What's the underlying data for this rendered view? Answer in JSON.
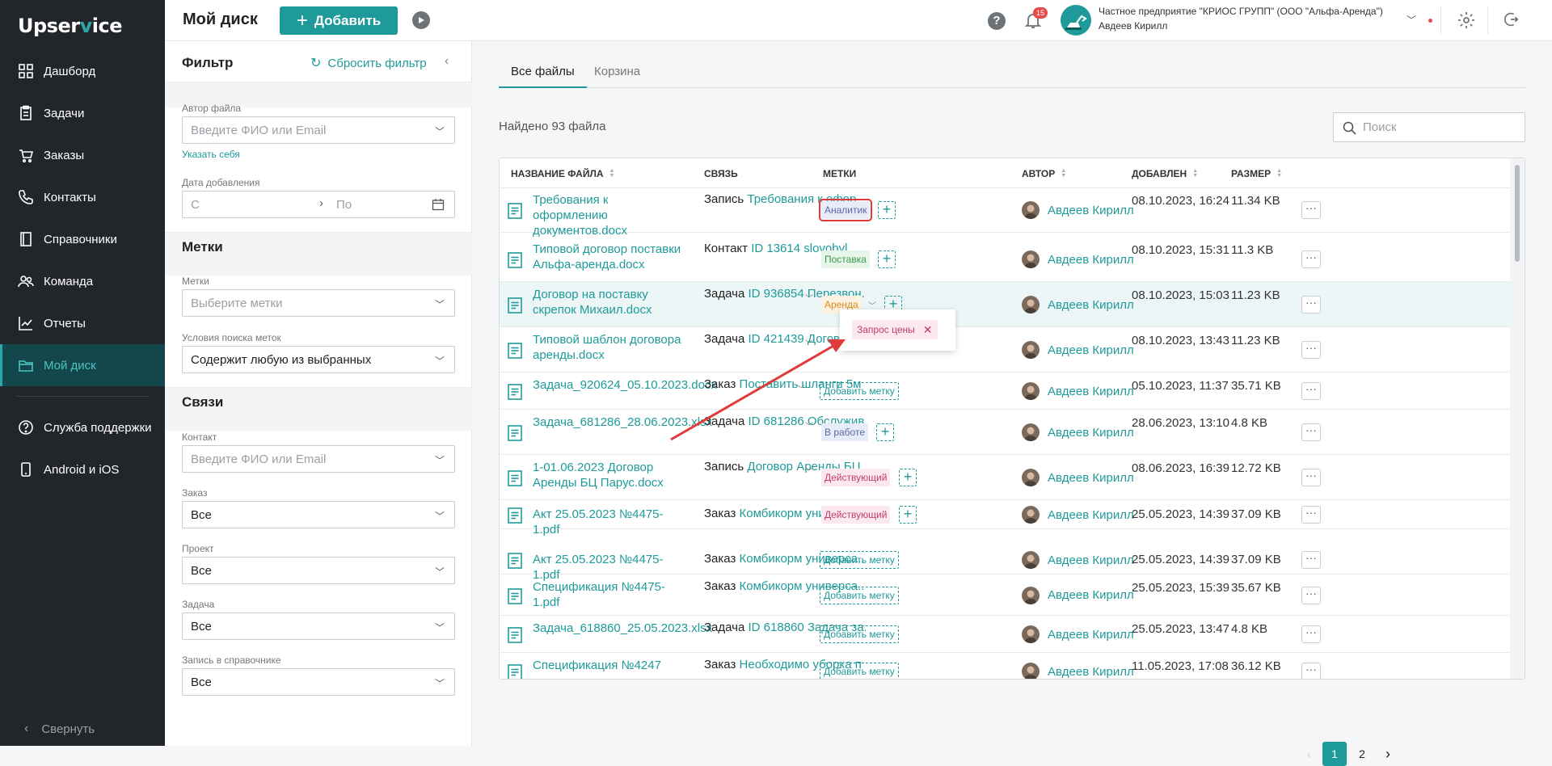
{
  "app": {
    "logo_prefix": "Upser",
    "logo_v": "v",
    "logo_suffix": "ice"
  },
  "sidebar": {
    "items": [
      {
        "label": "Дашборд",
        "icon": "grid-icon"
      },
      {
        "label": "Задачи",
        "icon": "clipboard-icon"
      },
      {
        "label": "Заказы",
        "icon": "cart-icon"
      },
      {
        "label": "Контакты",
        "icon": "phone-icon"
      },
      {
        "label": "Справочники",
        "icon": "book-icon"
      },
      {
        "label": "Команда",
        "icon": "team-icon"
      },
      {
        "label": "Отчеты",
        "icon": "chart-icon"
      },
      {
        "label": "Мой диск",
        "icon": "folder-icon"
      }
    ],
    "bottom_items": [
      {
        "label": "Служба поддержки",
        "icon": "help-icon"
      },
      {
        "label": "Android и iOS",
        "icon": "mobile-icon"
      }
    ],
    "collapse_label": "Свернуть"
  },
  "header": {
    "title": "Мой диск",
    "add_label": "Добавить",
    "notifications_count": "15",
    "company": "Частное предприятие \"КРИОС ГРУПП\" (ООО \"Альфа-Аренда\")",
    "user": "Авдеев Кирилл"
  },
  "filter": {
    "title": "Фильтр",
    "reset_label": "Сбросить фильтр",
    "author_label": "Автор файла",
    "author_placeholder": "Введите ФИО или Email",
    "self_link": "Указать себя",
    "date_label": "Дата добавления",
    "date_from": "С",
    "date_to": "По",
    "tags_section": "Метки",
    "tags_label": "Метки",
    "tags_placeholder": "Выберите метки",
    "cond_label": "Условия поиска меток",
    "cond_value": "Содержит любую из выбранных",
    "links_section": "Связи",
    "contact_label": "Контакт",
    "contact_placeholder": "Введите ФИО или Email",
    "order_label": "Заказ",
    "order_value": "Все",
    "project_label": "Проект",
    "project_value": "Все",
    "task_label": "Задача",
    "task_value": "Все",
    "record_label": "Запись в справочнике",
    "record_value": "Все"
  },
  "main": {
    "tabs": [
      "Все файлы",
      "Корзина"
    ],
    "found": "Найдено 93 файла",
    "search_placeholder": "Поиск",
    "columns": {
      "name": "НАЗВАНИЕ ФАЙЛА",
      "link": "СВЯЗЬ",
      "tags": "МЕТКИ",
      "author": "АВТОР",
      "added": "ДОБАВЛЕН",
      "size": "РАЗМЕР"
    },
    "rows": [
      {
        "name": "Требования к оформлению документов.docx",
        "link_type": "Запись",
        "link_text": "Требования к офор...",
        "tag": "Аналитик",
        "date": "08.10.2023, 16:24",
        "size": "11.34 KB",
        "author": "Авдеев Кирилл"
      },
      {
        "name": "Типовой договор поставки Альфа-аренда.docx",
        "link_type": "Контакт",
        "link_text": "ID 13614 slovobyl",
        "tag": "Поставка",
        "date": "08.10.2023, 15:31",
        "size": "11.3 KB",
        "author": "Авдеев Кирилл"
      },
      {
        "name": "Договор на поставку скрепок Михаил.docx",
        "link_type": "Задача",
        "link_text": "ID 936854 Перезвон...",
        "tag": "Аренда",
        "date": "08.10.2023, 15:03",
        "size": "11.23 KB",
        "author": "Авдеев Кирилл"
      },
      {
        "name": "Типовой шаблон договора аренды.docx",
        "link_type": "Задача",
        "link_text": "ID 421439 Догово...",
        "tag": "",
        "date": "08.10.2023, 13:43",
        "size": "11.23 KB",
        "author": "Авдеев Кирилл"
      },
      {
        "name": "Задача_920624_05.10.2023.docx",
        "link_type": "Заказ",
        "link_text": "Поставить шланги 5м",
        "tag": "Добавить метку",
        "date": "05.10.2023, 11:37",
        "size": "35.71 KB",
        "author": "Авдеев Кирилл"
      },
      {
        "name": "Задача_681286_28.06.2023.xlsx",
        "link_type": "Задача",
        "link_text": "ID 681286 Обслужив...",
        "tag": "В работе",
        "date": "28.06.2023, 13:10",
        "size": "4.8 KB",
        "author": "Авдеев Кирилл"
      },
      {
        "name": "1-01.06.2023 Договор Аренды БЦ Парус.docx",
        "link_type": "Запись",
        "link_text": "Договор Аренды БЦ ...",
        "tag": "Действующий",
        "date": "08.06.2023, 16:39",
        "size": "12.72 KB",
        "author": "Авдеев Кирилл"
      },
      {
        "name": "Акт 25.05.2023 №4475-1.pdf",
        "link_type": "Заказ",
        "link_text": "Комбикорм универса...",
        "tag": "Действующий",
        "date": "25.05.2023, 14:39",
        "size": "37.09 KB",
        "author": "Авдеев Кирилл"
      },
      {
        "name": "Акт 25.05.2023 №4475-1.pdf",
        "link_type": "Заказ",
        "link_text": "Комбикорм универса...",
        "tag": "Добавить метку",
        "date": "25.05.2023, 14:39",
        "size": "37.09 KB",
        "author": "Авдеев Кирилл"
      },
      {
        "name": "Спецификация №4475-1.pdf",
        "link_type": "Заказ",
        "link_text": "Комбикорм универса...",
        "tag": "Добавить метку",
        "date": "25.05.2023, 15:39",
        "size": "35.67 KB",
        "author": "Авдеев Кирилл"
      },
      {
        "name": "Задача_618860_25.05.2023.xlsx",
        "link_type": "Задача",
        "link_text": "ID 618860 Задача за...",
        "tag": "Добавить метку",
        "date": "25.05.2023, 13:47",
        "size": "4.8 KB",
        "author": "Авдеев Кирилл"
      },
      {
        "name": "Спецификация №4247",
        "link_type": "Заказ",
        "link_text": "Необходимо уборка п",
        "tag": "Добавить метку",
        "date": "11.05.2023, 17:08",
        "size": "36.12 KB",
        "author": "Авдеев Кирилл"
      }
    ],
    "popup_tag": "Запрос цены",
    "pagination": {
      "pages": [
        "1",
        "2"
      ],
      "current": "1"
    }
  },
  "colors": {
    "accent": "#1f9a9a",
    "sidebar": "#222529",
    "highlight_red": "#e03a3a"
  }
}
